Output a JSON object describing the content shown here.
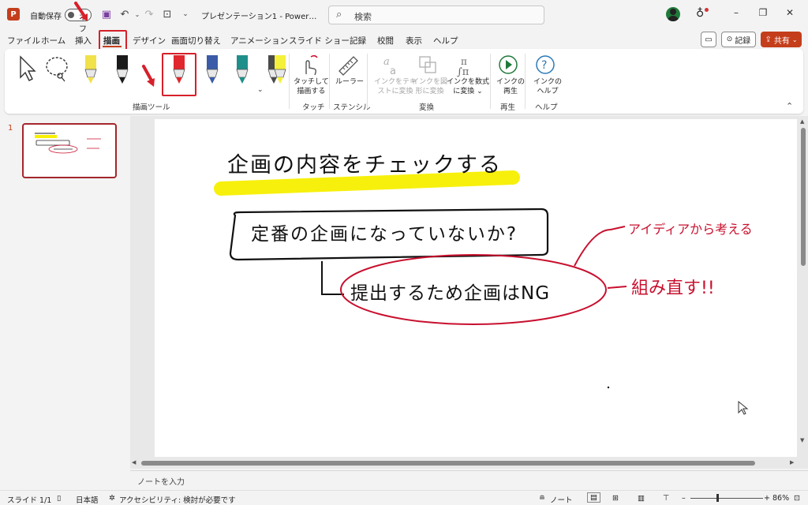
{
  "titlebar": {
    "app_logo": "P",
    "autosave_label": "自動保存",
    "autosave_state": "オフ",
    "doc_title": "プレゼンテーション1 - Power…",
    "search_placeholder": "検索"
  },
  "tabs": [
    {
      "label": "ファイル"
    },
    {
      "label": "ホーム"
    },
    {
      "label": "挿入"
    },
    {
      "label": "描画",
      "active": true
    },
    {
      "label": "デザイン"
    },
    {
      "label": "画面切り替え"
    },
    {
      "label": "アニメーション"
    },
    {
      "label": "スライド ショー"
    },
    {
      "label": "記録"
    },
    {
      "label": "校閲"
    },
    {
      "label": "表示"
    },
    {
      "label": "ヘルプ"
    }
  ],
  "header_buttons": {
    "record": "記録",
    "share": "共有"
  },
  "ribbon": {
    "groups": {
      "draw_tools": "描画ツール",
      "touch": "タッチ",
      "stencil": "ステンシル",
      "convert": "変換",
      "replay": "再生",
      "help": "ヘルプ"
    },
    "buttons": {
      "touch_draw_line1": "タッチして",
      "touch_draw_line2": "描画する",
      "ruler": "ルーラー",
      "ink_to_text_line1": "インクをテキ",
      "ink_to_text_line2": "ストに変換",
      "ink_to_shape_line1": "インクを図",
      "ink_to_shape_line2": "形に変換",
      "ink_to_math_line1": "インクを数式",
      "ink_to_math_line2": "に変換 ⌄",
      "ink_replay_line1": "インクの",
      "ink_replay_line2": "再生",
      "ink_help_line1": "インクの",
      "ink_help_line2": "ヘルプ"
    },
    "pens": [
      {
        "name": "select",
        "color": "#333333"
      },
      {
        "name": "lasso",
        "color": "#333333"
      },
      {
        "name": "pen-yellow",
        "color": "#f1e14a"
      },
      {
        "name": "pen-black",
        "color": "#1a1a1a"
      },
      {
        "name": "pen-red",
        "color": "#e0282e"
      },
      {
        "name": "pen-galaxy",
        "color": "#3b5ba8"
      },
      {
        "name": "pen-teal",
        "color": "#1f8f8a"
      },
      {
        "name": "pencil-gray",
        "color": "#4a4a4a"
      },
      {
        "name": "highlighter-yellow",
        "color": "#f5f03a"
      }
    ]
  },
  "thumbnail": {
    "number": "1"
  },
  "slide": {
    "title": "企画の内容をチェックする",
    "box1": "定番の企画になっていないか?",
    "box2": "提出するため企画はNG",
    "note1": "アイディアから考える",
    "note2": "組み直す!!"
  },
  "notes_placeholder": "ノートを入力",
  "statusbar": {
    "slide_counter": "スライド 1/1",
    "language": "日本語",
    "accessibility": "アクセシビリティ: 検討が必要です",
    "notes": "ノート",
    "zoom": "86%"
  },
  "colors": {
    "accent": "#c43e1c",
    "ink_red": "#c8102e",
    "highlight": "#f7f000",
    "selection": "#d6202a"
  }
}
